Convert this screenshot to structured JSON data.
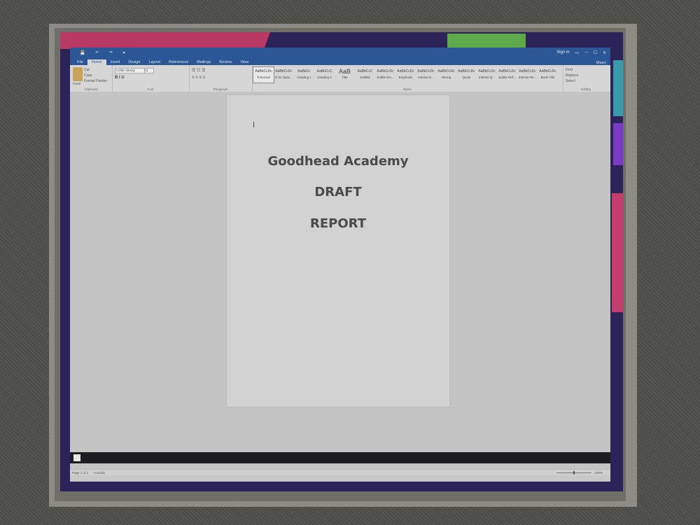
{
  "titlebar": {
    "quick_access": [
      "💾",
      "↶",
      "↷",
      "▾"
    ],
    "sign_in": "Sign in",
    "controls": [
      "▭",
      "─",
      "☐",
      "✕"
    ]
  },
  "tabs": [
    "File",
    "Home",
    "Insert",
    "Design",
    "Layout",
    "References",
    "Mailings",
    "Review",
    "View"
  ],
  "tabs_right": "Share",
  "ribbon": {
    "clipboard": {
      "paste": "Paste",
      "cut": "Cut",
      "copy": "Copy",
      "format_painter": "Format Painter",
      "label": "Clipboard"
    },
    "font": {
      "name": "Calibri (Body)",
      "size": "11",
      "label": "Font"
    },
    "paragraph": {
      "label": "Paragraph"
    },
    "styles": {
      "label": "Styles",
      "items": [
        {
          "sample": "AaBbCcDc",
          "name": "¶ Normal"
        },
        {
          "sample": "AaBbCcDc",
          "name": "¶ No Spac..."
        },
        {
          "sample": "AaBbCc",
          "name": "Heading 1"
        },
        {
          "sample": "AaBbCcC",
          "name": "Heading 2"
        },
        {
          "sample": "AaB",
          "name": "Title"
        },
        {
          "sample": "AaBbCcC",
          "name": "Subtitle"
        },
        {
          "sample": "AaBbCcDc",
          "name": "Subtle Em..."
        },
        {
          "sample": "AaBbCcDc",
          "name": "Emphasis"
        },
        {
          "sample": "AaBbCcDc",
          "name": "Intense E..."
        },
        {
          "sample": "AaBbCcDc",
          "name": "Strong"
        },
        {
          "sample": "AaBbCcDc",
          "name": "Quote"
        },
        {
          "sample": "AaBbCcDc",
          "name": "Intense Q..."
        },
        {
          "sample": "AaBbCcDc",
          "name": "Subtle Ref..."
        },
        {
          "sample": "AaBbCcDc",
          "name": "Intense Re..."
        },
        {
          "sample": "AaBbCcDc",
          "name": "Book Title"
        }
      ]
    },
    "editing": {
      "find": "Find",
      "replace": "Replace",
      "select": "Select",
      "label": "Editing"
    }
  },
  "document": {
    "lines": [
      "Goodhead Academy",
      "DRAFT",
      "REPORT"
    ]
  },
  "statusbar": {
    "page": "Page 1 of 1",
    "words": "0 words",
    "zoom": "100%"
  }
}
